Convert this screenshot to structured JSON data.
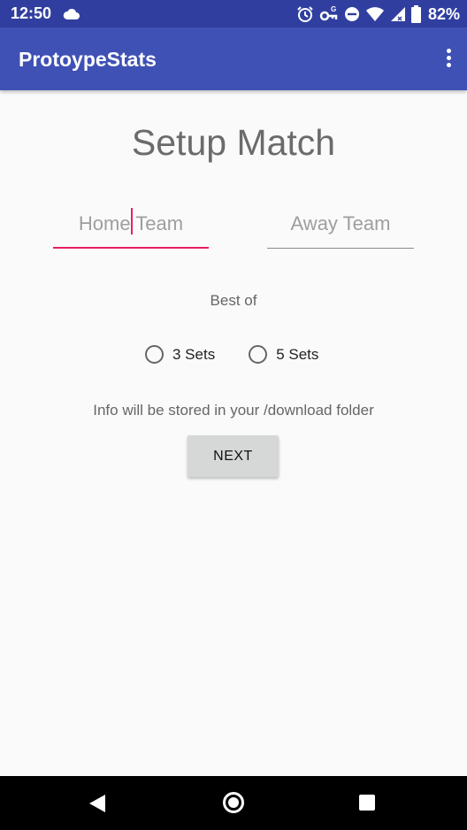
{
  "status_bar": {
    "time": "12:50",
    "battery": "82%",
    "icons": [
      "cloud-icon",
      "alarm-icon",
      "vpn-key-icon",
      "do-not-disturb-icon",
      "wifi-icon",
      "signal-icon",
      "battery-icon"
    ]
  },
  "app_bar": {
    "title": "ProtoypeStats",
    "menu_icon": "overflow-menu-icon"
  },
  "form": {
    "title": "Setup Match",
    "home_team": {
      "placeholder": "Home Team",
      "value": ""
    },
    "away_team": {
      "placeholder": "Away Team",
      "value": ""
    },
    "best_of_label": "Best of",
    "options": [
      {
        "label": "3 Sets",
        "selected": false
      },
      {
        "label": "5 Sets",
        "selected": false
      }
    ],
    "info": "Info will be stored in your /download folder",
    "next_label": "NEXT"
  },
  "colors": {
    "status_bar": "#303f9f",
    "app_bar": "#3f51b5",
    "accent": "#e91e63",
    "background": "#fafafa"
  },
  "nav_bar": {
    "icons": [
      "back-icon",
      "home-icon",
      "recents-icon"
    ]
  }
}
